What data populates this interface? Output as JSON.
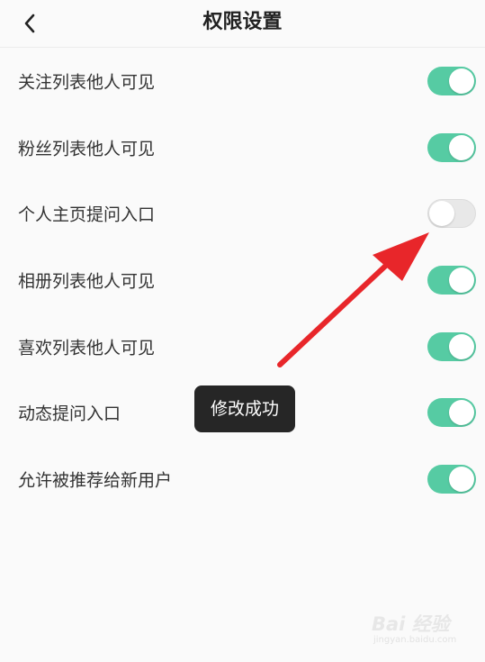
{
  "header": {
    "title": "权限设置",
    "back_icon": "chevron-left-icon"
  },
  "settings": [
    {
      "label": "关注列表他人可见",
      "enabled": true
    },
    {
      "label": "粉丝列表他人可见",
      "enabled": true
    },
    {
      "label": "个人主页提问入口",
      "enabled": false
    },
    {
      "label": "相册列表他人可见",
      "enabled": true
    },
    {
      "label": "喜欢列表他人可见",
      "enabled": true
    },
    {
      "label": "动态提问入口",
      "enabled": true
    },
    {
      "label": "允许被推荐给新用户",
      "enabled": true
    }
  ],
  "toast": {
    "message": "修改成功"
  },
  "colors": {
    "toggle_on": "#56cba3",
    "toggle_off": "#e8e8e8",
    "annotation_arrow": "#e8262a",
    "toast_bg": "#262626"
  },
  "watermark": {
    "brand": "Bai 经验",
    "url": "jingyan.baidu.com"
  }
}
